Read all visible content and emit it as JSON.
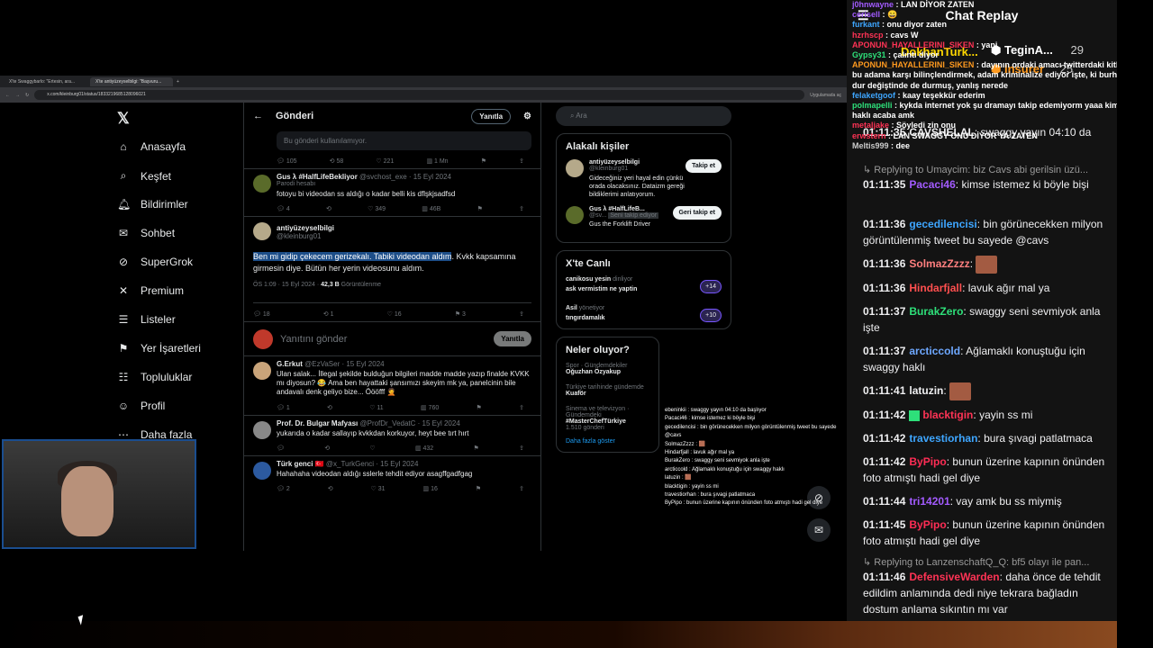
{
  "browser": {
    "tabs": [
      "X'te Swaggybarlo: \"Ertesin, ara...",
      "X'te antiyüzeyselbilgi: \"Başvuru..."
    ],
    "url": "x.com/kleinburg01/status/1833219685128096021",
    "extra": "Uygulamada aç"
  },
  "x": {
    "nav": [
      "Anasayfa",
      "Keşfet",
      "Bildirimler",
      "Sohbet",
      "SuperGrok",
      "Premium",
      "Listeler",
      "Yer İşaretleri",
      "Topluluklar",
      "Profil",
      "Daha fazla"
    ],
    "header": {
      "title": "Gönderi",
      "reply_pill": "Yanıtla"
    },
    "unavailable": "Bu gönderi kullanılamıyor.",
    "top_stats": [
      "105",
      "58",
      "221",
      "1 Mn"
    ],
    "tweet1": {
      "name": "Gus λ #HalfLifeBekliyor",
      "handle": "@svchost_exe · 15 Eyl 2024",
      "badge": "Parodi hesabı",
      "text": "fotoyu bi videodan ss aldığı o kadar belli kis dflşkjsadfsd",
      "stats": [
        "4",
        "",
        "349",
        "46B"
      ]
    },
    "main": {
      "name": "antiyüzeyselbilgi",
      "handle": "@kleinburg01",
      "text_hl": "Ben mi gidip çekecem gerizekalı. Tabiki videodan aldım",
      "text_rest": ". Kvkk kapsamına girmesin diye. Bütün her yerin videosunu aldım.",
      "meta": "ÖS 1:09 · 15 Eyl 2024 · ",
      "views": "42,3 B",
      "views_label": " Görüntülenme",
      "stats": [
        "18",
        "1",
        "16",
        "3"
      ]
    },
    "compose": {
      "placeholder": "Yanıtını gönder",
      "button": "Yanıtla"
    },
    "tweet2": {
      "name": "G.Erkut",
      "handle": "@EzVaSer · 15 Eyl 2024",
      "text": "Ulan salak... İllegal şekilde bulduğun bilgileri madde madde yazıp finalde KVKK mı diyosun? 😂 Ama ben hayattaki şansımızı skeyim mk ya, panelcinin bile andavalı denk geliyo bize... Öööfff 🤦",
      "stats": [
        "1",
        "",
        "11",
        "760"
      ]
    },
    "tweet3": {
      "name": "Prof. Dr. Bulgar Mafyası",
      "handle": "@ProfDr_VedatC · 15 Eyl 2024",
      "text": "yukarıda o kadar sallayıp kvkkdan korkuyor, heyt bee tırt hırt",
      "stats": [
        "",
        "",
        "",
        "432"
      ]
    },
    "tweet4": {
      "name": "Türk genci 🇹🇷",
      "handle": "@x_TurkGenci · 15 Eyl 2024",
      "text": "Hahahaha videodan aldığı sslerle tehdit ediyor asagffgadfgag",
      "stats": [
        "2",
        "",
        "31",
        "16"
      ]
    },
    "search_placeholder": "Ara",
    "related": {
      "title": "Alakalı kişiler",
      "p1": {
        "name": "antiyüzeyselbilgi",
        "handle": "@kleinburg01",
        "bio": "Gideceğiniz yeri hayal edin çünkü orada olacaksınız. Dataizm gereği bildiklerimi anlatıyorum.",
        "btn": "Takip et"
      },
      "p2": {
        "name": "Gus λ #HalfLifeB...",
        "handle": "@sv...",
        "tag": "Seni takip ediyor",
        "bio": "Gus the Forklift Driver",
        "btn": "Geri takip et"
      }
    },
    "live": {
      "title": "X'te Canlı",
      "s1": {
        "host": "canikosu yesin",
        "status": "dinliyor",
        "title": "ask vermistim ne yaptin",
        "count": "+14"
      },
      "s2": {
        "host": "Asil",
        "status": "yönetiyor",
        "title": "tıngırdamalık",
        "count": "+10"
      }
    },
    "trends": {
      "title": "Neler oluyor?",
      "t1": {
        "cat": "Spor · Gündemdekiler",
        "name": "Oğuzhan Özyakup"
      },
      "t2": {
        "cat": "Türkiye tarihinde gündemde",
        "name": "Kuaför"
      },
      "t3": {
        "cat": "Sinema ve televizyon · Gündemdeki",
        "name": "#MasterChefTürkiye",
        "count": "1.510 gönderi"
      },
      "more": "Daha fazla göster"
    }
  },
  "overlay_chat": [
    "ebeninkii : swaggy yayın 04:10 da başlıyor",
    "Pacaci46 : kimse istemez ki böyle bişi",
    "gecedilencisi : bin görünecekken milyon görüntülenmiş tweet bu sayede @cavs",
    "SolmazZzzz : 🟫",
    "Hindarfjall : lavuk ağır mal ya",
    "BurakZero : swaggy seni sevmiyok anla işte",
    "arcticcold : Ağlamaklı konuştuğu için swaggy haklı",
    "latuzin : 🟫",
    "blacktigin : yayin ss mi",
    "travestiorhan : bura şıvagi patlatmaca",
    "ByPipo : bunun üzerine kapının önünden foto atmıştı hadi gel diye"
  ],
  "top_overlay": [
    {
      "u": "j0hnwayne",
      "t": " : LAN DİYOR ZATEN"
    },
    {
      "u": "cerisell",
      "t": " : 😄"
    },
    {
      "u": "furkant",
      "t": " : onu diyor zaten"
    },
    {
      "u": "hzrhscp",
      "t": " : cavs W"
    },
    {
      "u": "APONUN_HAYALLERINI_SIKEN",
      "t": " : yani"
    },
    {
      "u": "Gypsy31",
      "t": " : çalıntı diyor"
    },
    {
      "u": "APONUN_HAYALLERINI_SIKEN",
      "t": " : dayının ordaki amacı twitterdaki kitleyi bu adama karşı bilinçlendirmek, adam kriminalize ediyor işte, ki burhi dur değiştinde de durmuş, yanlış nerede"
    },
    {
      "u": "felaketgoof",
      "t": " : kaay teşekkür ederim"
    },
    {
      "u": "polmapelli",
      "t": " : kykda internet yok şu dramayı takip edemiyorm yaaa kim haklı acaba amk"
    },
    {
      "u": "metaljake",
      "t": " : Söyledi zin onu"
    },
    {
      "u": "erwstern",
      "t": " : LAN SWAGGY ONU DİYOR YA ZATEN"
    },
    {
      "u": "Meltis999",
      "t": " : dee"
    }
  ],
  "chat": {
    "title": "Chat Replay",
    "leaderboard": [
      {
        "name": "DokhanTurk...",
        "value": ""
      },
      {
        "name": "TeginA...",
        "value": "29"
      },
      {
        "name": "Insurer",
        "value": "25"
      }
    ],
    "lines": [
      {
        "ts": "01:11:35",
        "user": "CAVSHELAL",
        "color": "#ffffff",
        "text": "swaggy yayın 04:10 da"
      },
      {
        "reply": "Replying to Umaycim: biz Cavs abi gerilsin üzü..."
      },
      {
        "ts": "01:11:35",
        "user": "Pacaci46",
        "color": "#a35bff",
        "text": "kimse istemez ki böyle bişi"
      },
      {
        "ts": "01:11:36",
        "user": "gecedilencisi",
        "color": "#3ea6ff",
        "text": "bin görünecekken milyon görüntülenmiş tweet bu sayede @cavs"
      },
      {
        "ts": "01:11:36",
        "user": "SolmazZzzz",
        "color": "#ff7f7f",
        "text": ""
      },
      {
        "ts": "01:11:36",
        "user": "Hindarfjall",
        "color": "#ff4f4f",
        "text": "lavuk ağır mal ya"
      },
      {
        "ts": "01:11:37",
        "user": "BurakZero",
        "color": "#2ee07a",
        "text": "swaggy seni sevmiyok anla işte"
      },
      {
        "ts": "01:11:37",
        "user": "arcticcold",
        "color": "#6ea8ff",
        "text": "Ağlamaklı konuştuğu için swaggy haklı"
      },
      {
        "ts": "01:11:41",
        "user": "latuzin",
        "color": "#ffffff",
        "text": ""
      },
      {
        "ts": "01:11:42",
        "user": "blacktigin",
        "color": "#ff3355",
        "text": "yayin ss mi"
      },
      {
        "ts": "01:11:42",
        "user": "travestiorhan",
        "color": "#3ea6ff",
        "text": "bura şıvagi patlatmaca"
      },
      {
        "ts": "01:11:42",
        "user": "ByPipo",
        "color": "#ff2d55",
        "text": "bunun üzerine kapının önünden foto atmıştı hadi gel diye"
      },
      {
        "ts": "01:11:44",
        "user": "tri14201",
        "color": "#a35bff",
        "text": "vay amk bu ss miymiş"
      },
      {
        "ts": "01:11:45",
        "user": "ByPipo",
        "color": "#ff2d55",
        "text": "bunun üzerine kapının önünden foto atmıştı hadi gel diye"
      },
      {
        "reply": "Replying to LanzenschaftQ_Q: bf5 olayı ile pan..."
      },
      {
        "ts": "01:11:46",
        "user": "DefensiveWarden",
        "color": "#ff3355",
        "text": "daha önce de tehdit edildim anlamında dedi niye tekrara bağladın dostum anlama sıkıntın mı var"
      }
    ]
  }
}
